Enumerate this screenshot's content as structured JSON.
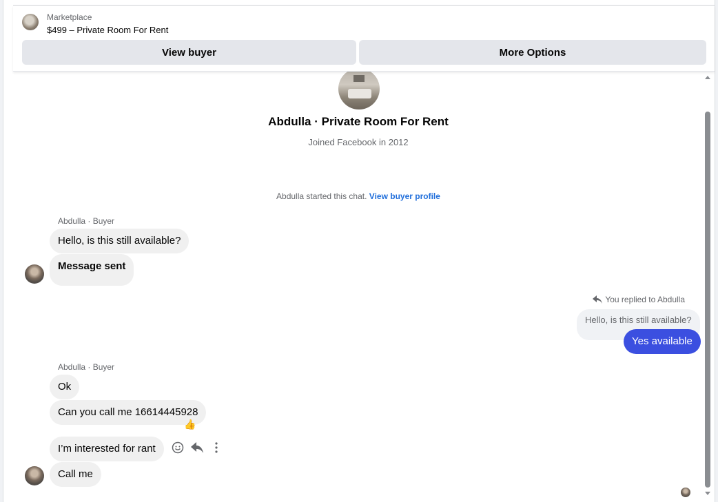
{
  "listing": {
    "kicker": "Marketplace",
    "title": "$499 – Private Room For Rent"
  },
  "buttons": {
    "view_buyer": "View buyer",
    "more_options": "More Options"
  },
  "profile": {
    "name": "Abdulla · Private Room For Rent",
    "joined": "Joined Facebook in 2012"
  },
  "chat_start": {
    "text": "Abdulla started this chat.",
    "link": "View buyer profile"
  },
  "groups": [
    {
      "sender": "Abdulla · Buyer",
      "messages": [
        "Hello, is this still available?",
        "Message sent"
      ]
    },
    {
      "sender": "Abdulla · Buyer",
      "messages": [
        "Ok",
        "Can you call me 16614445928",
        "I’m interested for rant",
        "Call me"
      ]
    }
  ],
  "reply": {
    "note": "You replied to Abdulla",
    "quoted": "Hello, is this still available?",
    "message": "Yes available"
  },
  "reaction_emoji": "👍",
  "colors": {
    "accent_bubble": "#3b4fe0",
    "link": "#216fdb",
    "incoming_bubble": "#f0f0f0",
    "button_bg": "#e4e6eb"
  },
  "icons": {
    "react": "emoji-icon",
    "reply": "reply-icon",
    "more": "more-vertical-icon"
  }
}
